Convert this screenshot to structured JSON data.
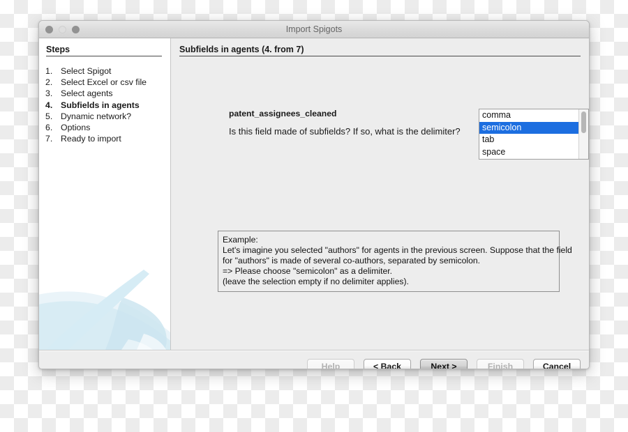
{
  "window": {
    "title": "Import Spigots",
    "traffic_lights": [
      "close-button",
      "minimize-button",
      "maximize-button"
    ]
  },
  "sidebar": {
    "heading": "Steps",
    "items": [
      {
        "num": "1.",
        "label": "Select Spigot",
        "active": false
      },
      {
        "num": "2.",
        "label": "Select Excel or csv file",
        "active": false
      },
      {
        "num": "3.",
        "label": "Select agents",
        "active": false
      },
      {
        "num": "4.",
        "label": "Subfields in agents",
        "active": true
      },
      {
        "num": "5.",
        "label": "Dynamic network?",
        "active": false
      },
      {
        "num": "6.",
        "label": "Options",
        "active": false
      },
      {
        "num": "7.",
        "label": "Ready to import",
        "active": false
      }
    ]
  },
  "main": {
    "heading": "Subfields in agents (4. from 7)",
    "field_label": "patent_assignees_cleaned",
    "question": "Is this field made of subfields? If so, what is the delimiter?",
    "delimiter_list": {
      "options": [
        "comma",
        "semicolon",
        "tab",
        "space"
      ],
      "selected": "semicolon",
      "selected_index": 1
    },
    "example": {
      "lines": [
        "Example:",
        "Let's imagine you selected \"authors\" for agents in the previous screen. Suppose that the field",
        "for \"authors\" is made of several co-authors, separated by semicolon.",
        "=> Please choose \"semicolon\" as a delimiter.",
        "(leave the selection empty if no delimiter applies)."
      ]
    }
  },
  "footer": {
    "buttons": [
      {
        "label": "Help",
        "state": "disabled"
      },
      {
        "label": "< Back",
        "state": "normal"
      },
      {
        "label": "Next >",
        "state": "default"
      },
      {
        "label": "Finish",
        "state": "disabled"
      },
      {
        "label": "Cancel",
        "state": "normal"
      }
    ]
  },
  "colors": {
    "selection_blue": "#1c6ee0",
    "window_chrome": "#ededed",
    "sidebar_bg": "#ffffff",
    "swoosh_blue": "#c9e2ee"
  }
}
